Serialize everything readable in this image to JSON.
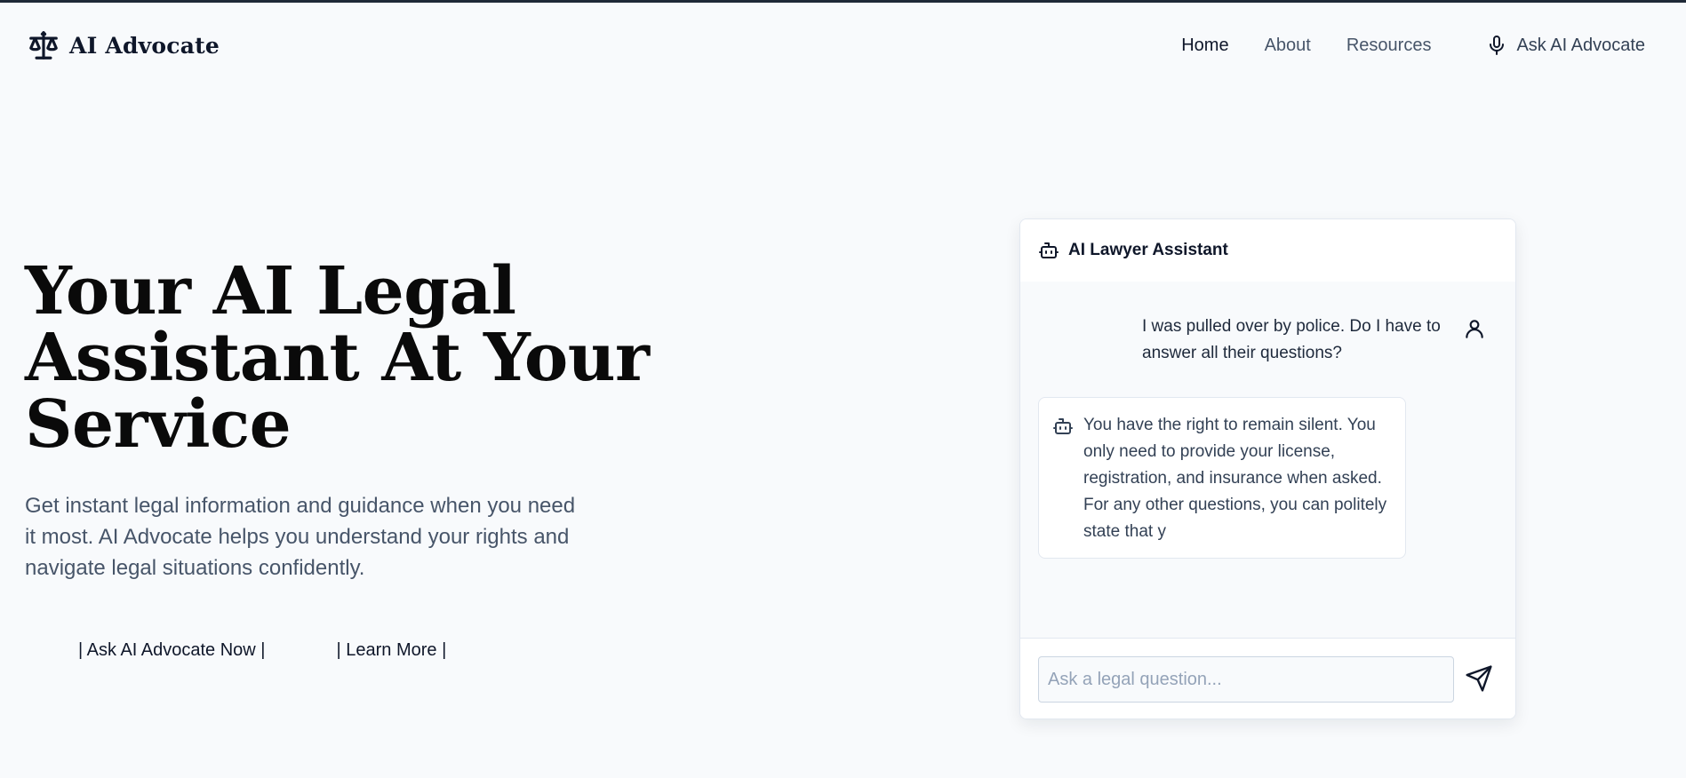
{
  "brand": {
    "name": "AI Advocate",
    "icon": "scales-icon"
  },
  "nav": {
    "links": [
      "Home",
      "About",
      "Resources"
    ],
    "active": "Home",
    "ask_label": "Ask AI Advocate",
    "ask_icon": "microphone-icon"
  },
  "hero": {
    "title_lines": [
      "Your AI Legal",
      "Assistant At Your",
      "Service"
    ],
    "subtitle": "Get instant legal information and guidance when you need it most. AI Advocate helps you understand your rights and navigate legal situations confidently.",
    "primary_button": "| Ask AI Advocate Now |",
    "secondary_button": "| Learn More |"
  },
  "chat": {
    "title": "AI Lawyer Assistant",
    "header_icon": "robot-icon",
    "messages": [
      {
        "role": "user",
        "icon": "user-icon",
        "text": "I was pulled over by police. Do I have to answer all their questions?"
      },
      {
        "role": "assistant",
        "icon": "robot-icon",
        "text": "You have the right to remain silent. You only need to provide your license, registration, and insurance when asked. For any other questions, you can politely state that y"
      }
    ],
    "input_placeholder": "Ask a legal question...",
    "send_icon": "send-icon"
  },
  "colors": {
    "background": "#f8fafc",
    "text_dark": "#0f172a",
    "text_muted": "#475569",
    "card_border": "#e2e8f0"
  }
}
